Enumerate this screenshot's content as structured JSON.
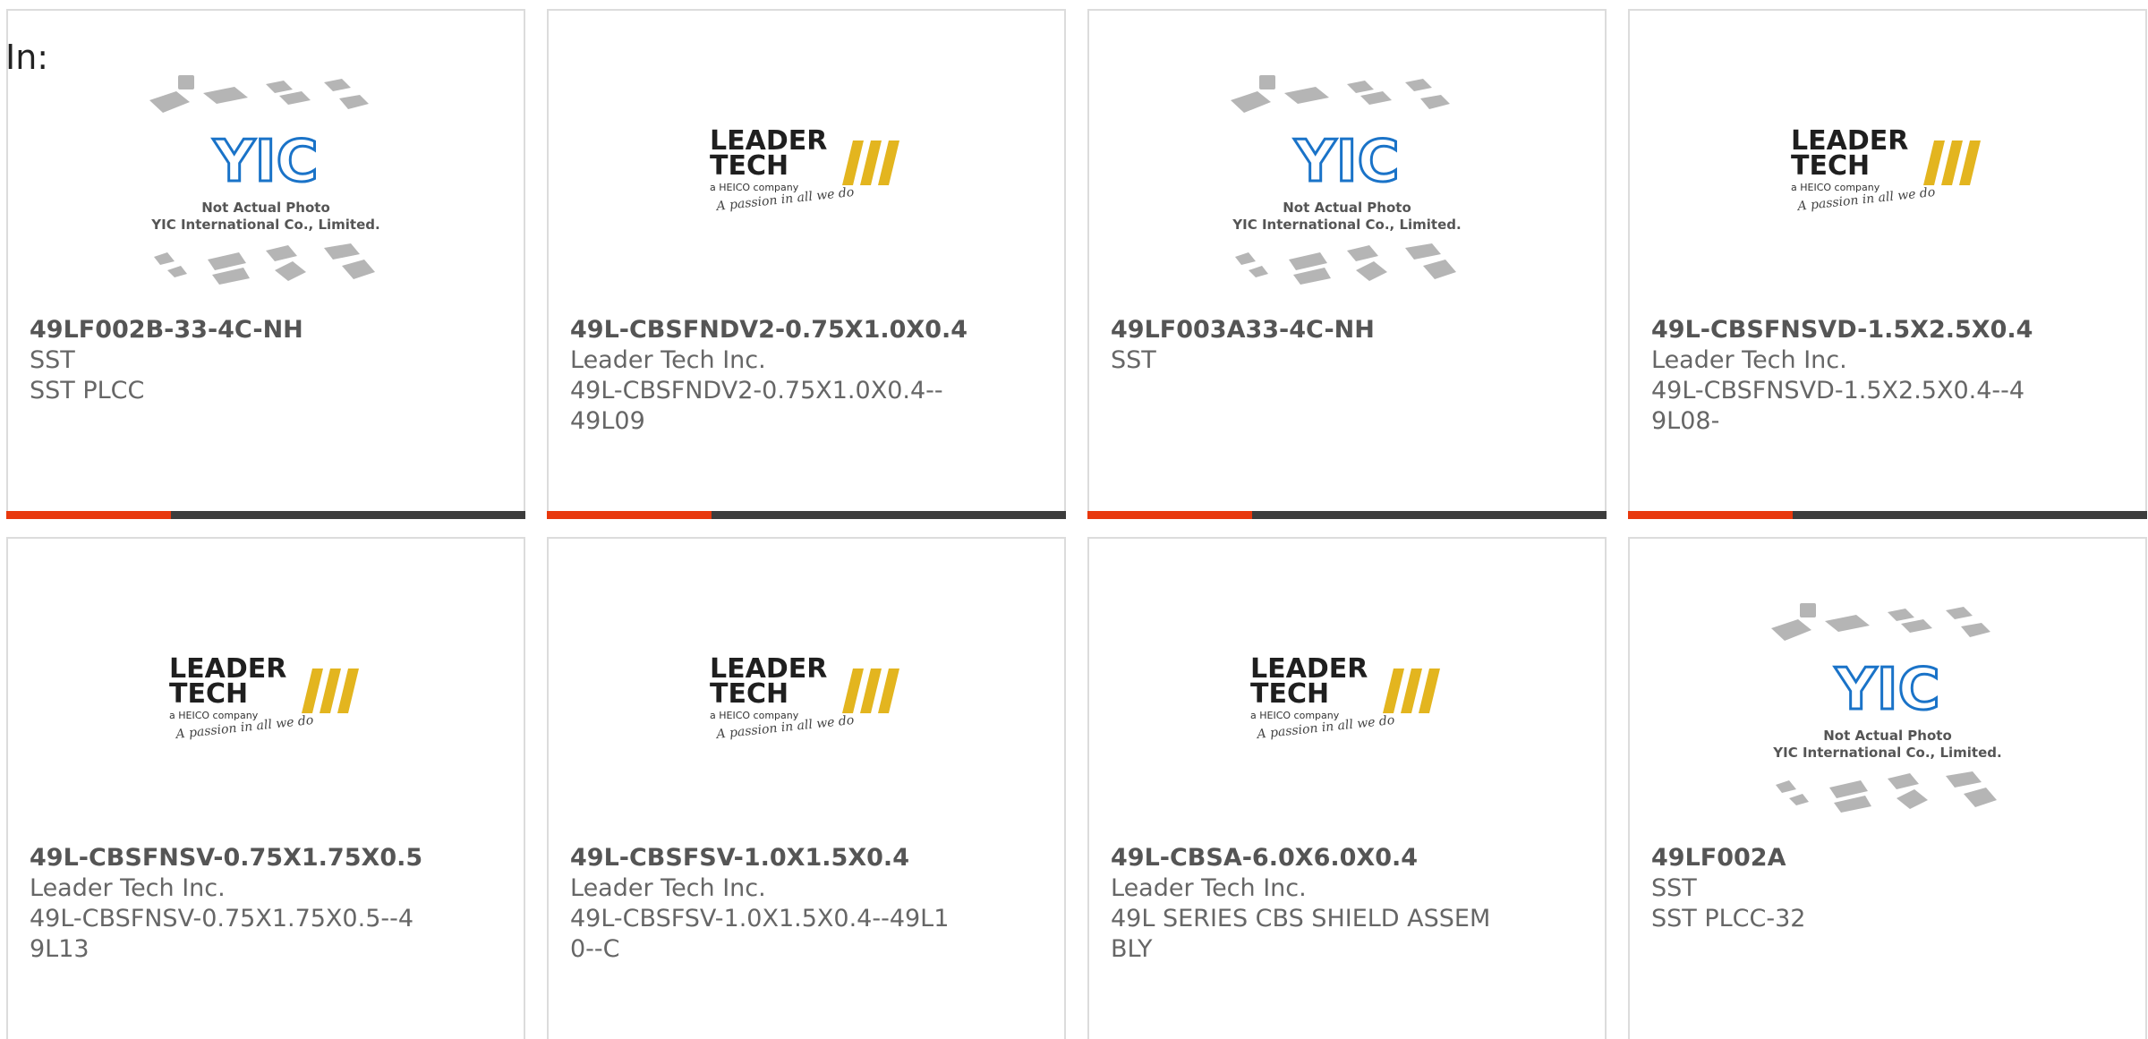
{
  "header": {
    "label": "In:"
  },
  "colors": {
    "accent": "#e8380d",
    "bar": "#3c3c3c",
    "yic_blue": "#1a73c8",
    "leader_yellow": "#e3b51f"
  },
  "products": [
    {
      "part_number": "49LF002B-33-4C-NH",
      "maker": "SST",
      "desc": "SST PLCC",
      "image": "yic-not-actual-photo"
    },
    {
      "part_number": "49L-CBSFNDV2-0.75X1.0X0.4",
      "maker": "Leader Tech Inc.",
      "desc": "49L-CBSFNDV2-0.75X1.0X0.4--49L09",
      "image": "leader-tech-logo"
    },
    {
      "part_number": "49LF003A33-4C-NH",
      "maker": "SST",
      "desc": "",
      "image": "yic-not-actual-photo"
    },
    {
      "part_number": "49L-CBSFNSVD-1.5X2.5X0.4",
      "maker": "Leader Tech Inc.",
      "desc": "49L-CBSFNSVD-1.5X2.5X0.4--49L08-",
      "image": "leader-tech-logo"
    },
    {
      "part_number": "49L-CBSFNSV-0.75X1.75X0.5",
      "maker": "Leader Tech Inc.",
      "desc": "49L-CBSFNSV-0.75X1.75X0.5--49L13",
      "image": "leader-tech-logo"
    },
    {
      "part_number": "49L-CBSFSV-1.0X1.5X0.4",
      "maker": "Leader Tech Inc.",
      "desc": "49L-CBSFSV-1.0X1.5X0.4--49L10--C",
      "image": "leader-tech-logo"
    },
    {
      "part_number": "49L-CBSA-6.0X6.0X0.4",
      "maker": "Leader Tech Inc.",
      "desc": "49L SERIES CBS SHIELD ASSEMBLY",
      "image": "leader-tech-logo"
    },
    {
      "part_number": "49LF002A",
      "maker": "SST",
      "desc": "SST PLCC-32",
      "image": "yic-not-actual-photo"
    }
  ],
  "logos": {
    "yic": {
      "mark": "YIC",
      "line1": "Not Actual Photo",
      "line2": "YIC International Co., Limited."
    },
    "leader": {
      "line1": "LEADER",
      "line2": "TECH",
      "tagline": "a HEICO company",
      "script": "A passion in all we do"
    }
  }
}
